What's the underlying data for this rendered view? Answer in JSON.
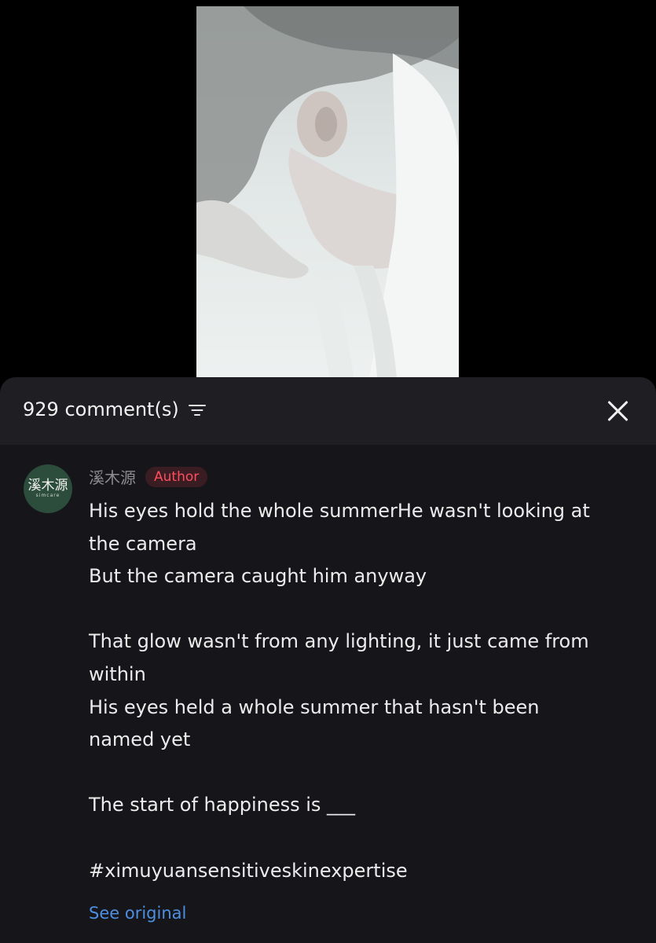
{
  "video": {
    "thumbnail_icon": "video-frame-image"
  },
  "header": {
    "comment_count_label": "929 comment(s)",
    "sort_icon": "sort-filter-icon",
    "close_icon": "close-icon"
  },
  "comment": {
    "avatar_text": "溪木源",
    "avatar_subtext": "simcare",
    "username": "溪木源",
    "badge": "Author",
    "lines": [
      "His eyes hold the whole summerHe wasn't looking at",
      "the camera",
      "But the camera caught him anyway",
      "",
      "That glow wasn't from any lighting, it just came from",
      "within",
      "His eyes held a whole summer that hasn't been",
      "named yet",
      "",
      "The start of happiness is ___",
      "",
      "#ximuyuansensitiveskinexpertise"
    ],
    "see_original": "See original"
  },
  "colors": {
    "sheet_background": "#16161a",
    "header_background": "#1f1f23",
    "badge_text": "#ff4d5e",
    "link": "#4d8fe0",
    "avatar_background": "#2c4c3c"
  }
}
